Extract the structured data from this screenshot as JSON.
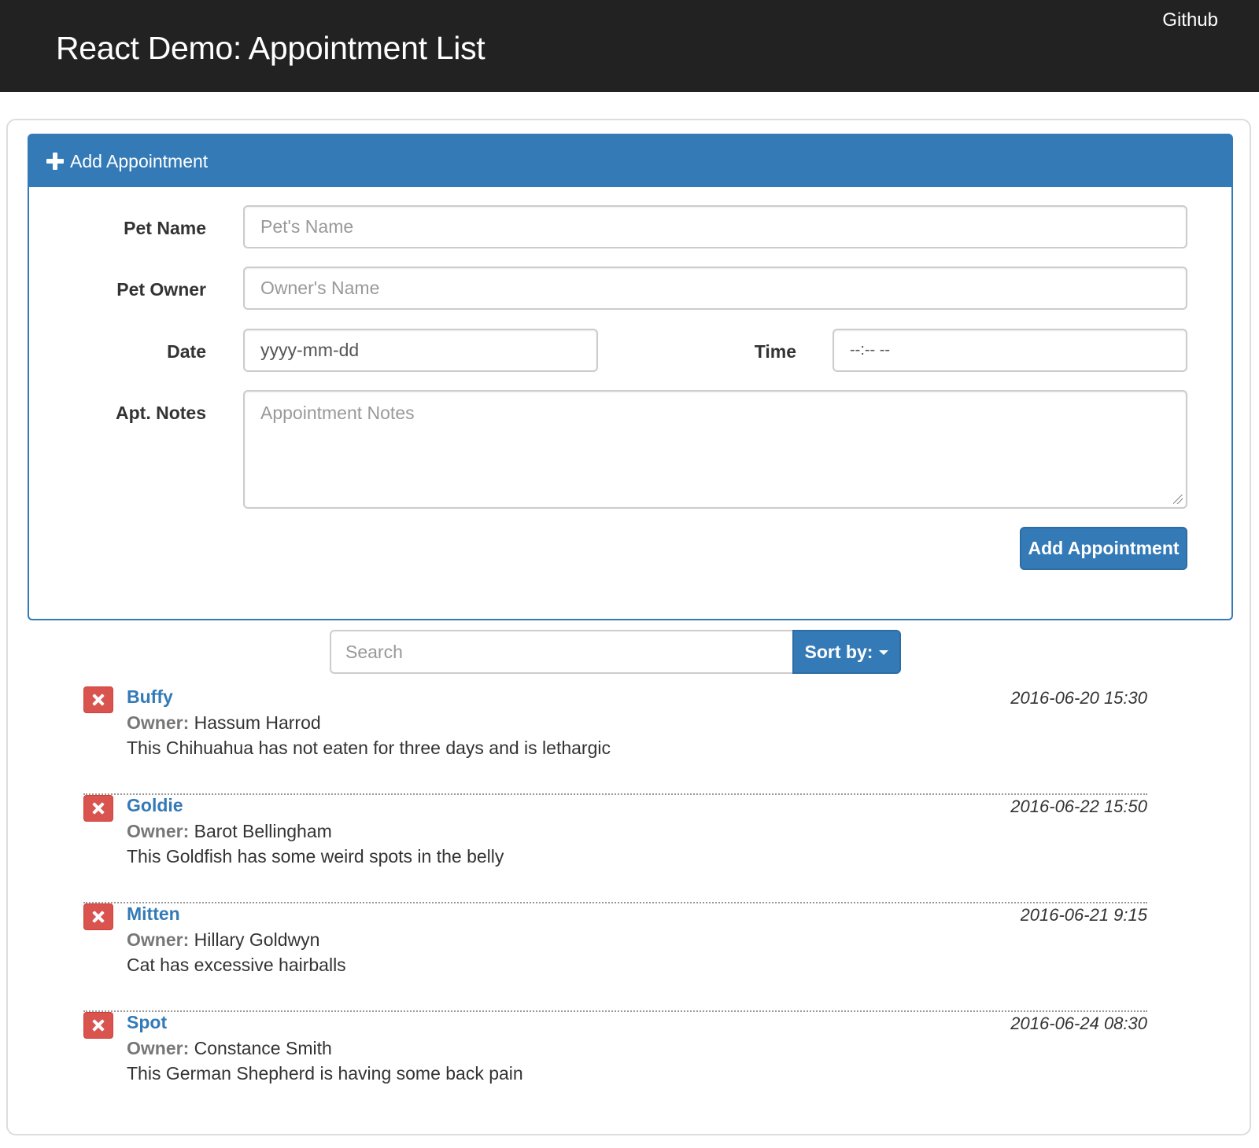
{
  "navbar": {
    "title": "React Demo: Appointment List",
    "github_label": "Github"
  },
  "add_panel": {
    "heading": "Add Appointment",
    "pet_name_label": "Pet Name",
    "pet_name_placeholder": "Pet's Name",
    "pet_owner_label": "Pet Owner",
    "pet_owner_placeholder": "Owner's Name",
    "date_label": "Date",
    "date_value": "yyyy-mm-dd",
    "time_label": "Time",
    "time_value": "--:-- --",
    "notes_label": "Apt. Notes",
    "notes_placeholder": "Appointment Notes",
    "submit_label": "Add Appointment"
  },
  "search": {
    "placeholder": "Search",
    "sort_label": "Sort by:"
  },
  "owner_prefix": "Owner:",
  "appointments": [
    {
      "pet": "Buffy",
      "owner": "Hassum Harrod",
      "date": "2016-06-20 15:30",
      "notes": "This Chihuahua has not eaten for three days and is lethargic"
    },
    {
      "pet": "Goldie",
      "owner": "Barot Bellingham",
      "date": "2016-06-22 15:50",
      "notes": "This Goldfish has some weird spots in the belly"
    },
    {
      "pet": "Mitten",
      "owner": "Hillary Goldwyn",
      "date": "2016-06-21 9:15",
      "notes": "Cat has excessive hairballs"
    },
    {
      "pet": "Spot",
      "owner": "Constance Smith",
      "date": "2016-06-24 08:30",
      "notes": "This German Shepherd is having some back pain"
    }
  ],
  "colors": {
    "navbar_bg": "#222222",
    "primary": "#337ab7",
    "danger": "#d9534f"
  }
}
